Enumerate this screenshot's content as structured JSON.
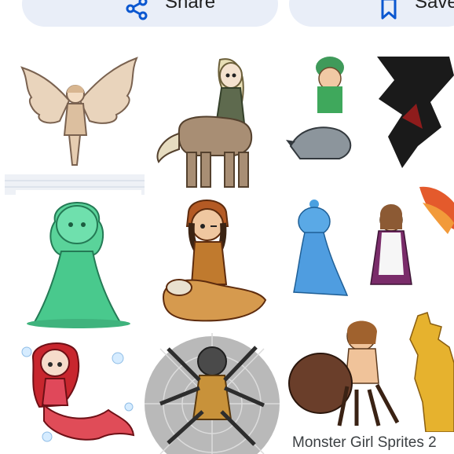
{
  "actions": {
    "share_label": "Share",
    "save_label": "Save",
    "share_icon": "share-icon",
    "save_icon": "bookmark-icon"
  },
  "images": {
    "column_left": [
      {
        "name": "harpy-image",
        "icon": "winged-girl"
      },
      {
        "name": "slime-girl-image",
        "icon": "slime-girl"
      },
      {
        "name": "mermaid-image",
        "icon": "mermaid"
      }
    ],
    "column_mid": [
      {
        "name": "centaur-image",
        "icon": "centaur"
      },
      {
        "name": "lamia-image",
        "icon": "snake-girl"
      },
      {
        "name": "arachne-image",
        "icon": "spider-girl"
      }
    ],
    "result_card": {
      "caption": "Monster Girl Sprites 2"
    }
  },
  "colors": {
    "chip_background": "#e9eef8",
    "icon_blue": "#0b57d0",
    "caption_text": "#3c4043"
  }
}
